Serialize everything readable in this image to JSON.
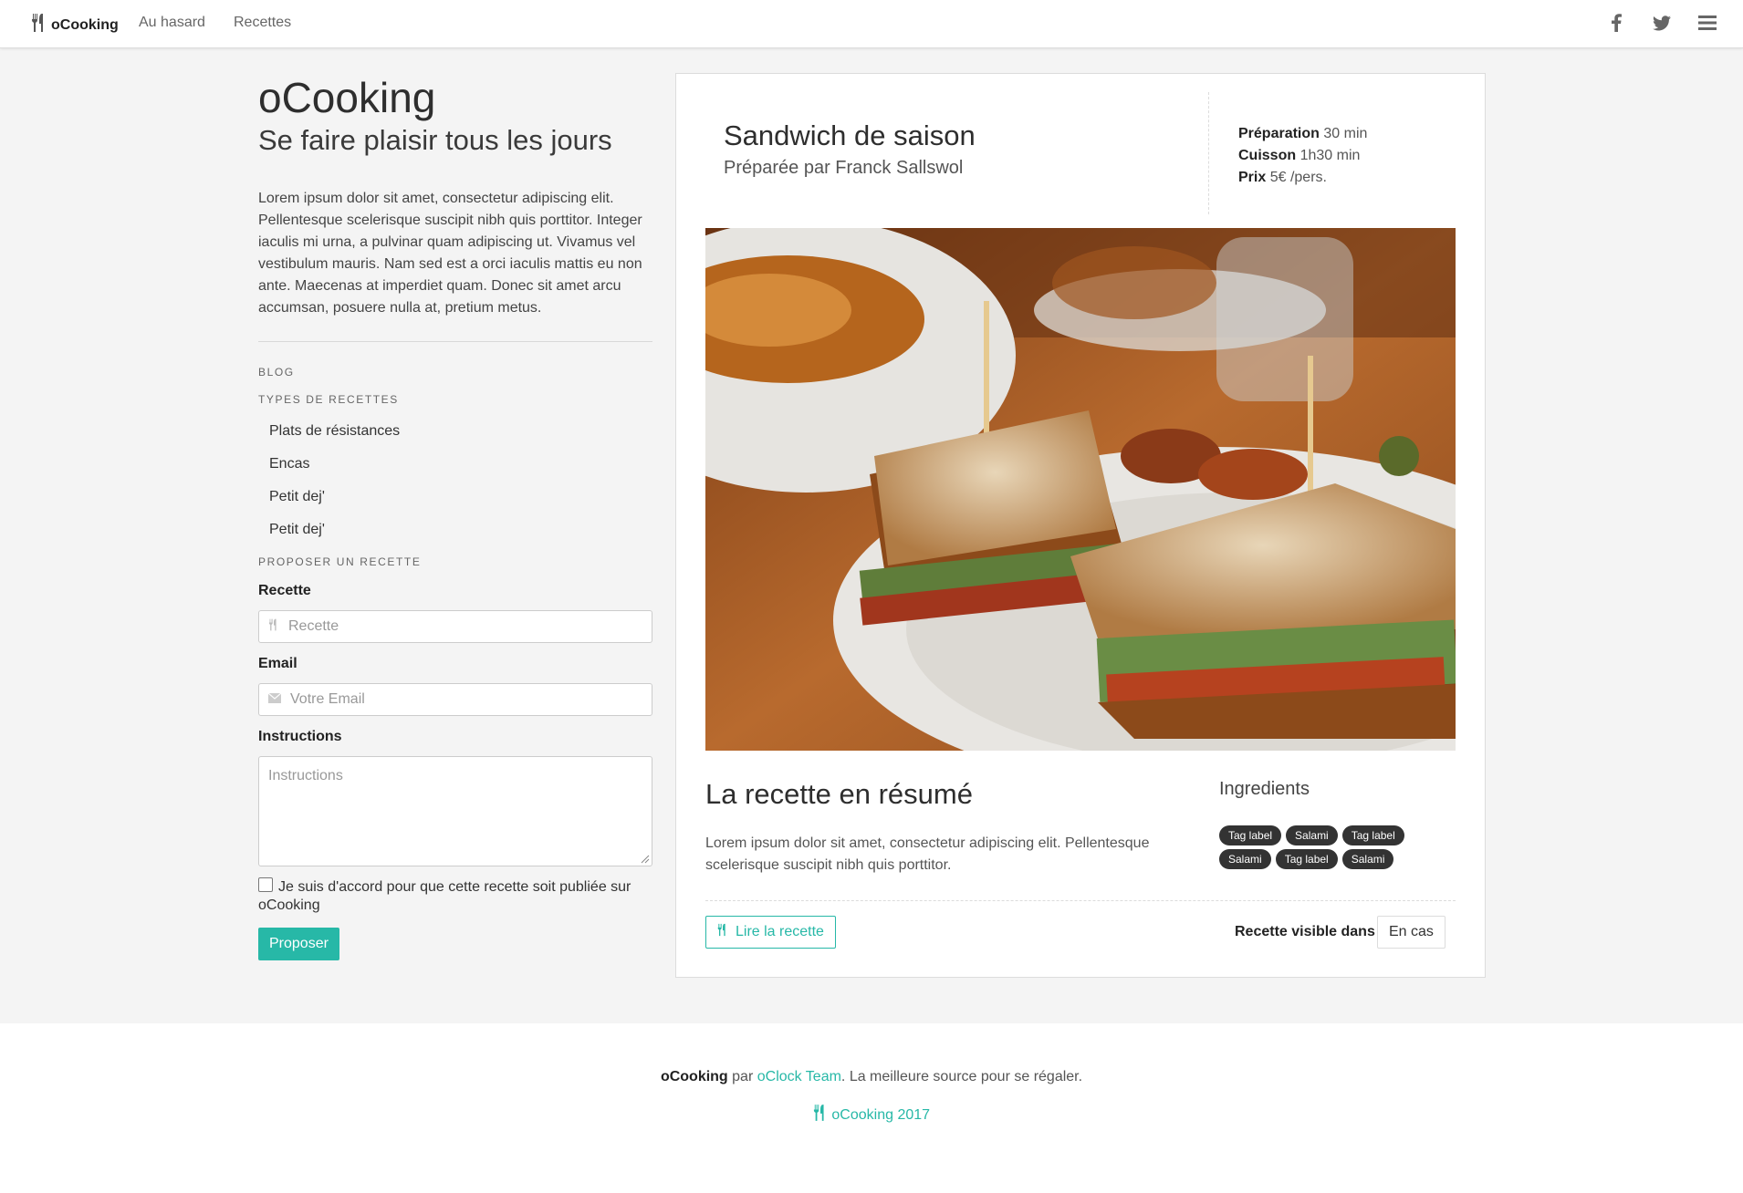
{
  "nav": {
    "brand": "oCooking",
    "links": [
      "Au hasard",
      "Recettes"
    ],
    "icons": [
      "facebook-icon",
      "twitter-icon",
      "menu-icon"
    ]
  },
  "sidebar": {
    "title": "oCooking",
    "tagline": "Se faire plaisir tous les jours",
    "intro": "Lorem ipsum dolor sit amet, consectetur adipiscing elit. Pellentesque scelerisque suscipit nibh quis porttitor. Integer iaculis mi urna, a pulvinar quam adipiscing ut. Vivamus vel vestibulum mauris. Nam sed est a orci iaculis mattis eu non ante. Maecenas at imperdiet quam. Donec sit amet arcu accumsan, posuere nulla at, pretium metus.",
    "blog_heading": "BLOG",
    "types_heading": "TYPES DE RECETTES",
    "types": [
      "Plats de résistances",
      "Encas",
      "Petit dej'",
      "Petit dej'"
    ],
    "propose_heading": "PROPOSER UN RECETTE",
    "form": {
      "recipe_label": "Recette",
      "recipe_placeholder": "Recette",
      "email_label": "Email",
      "email_placeholder": "Votre Email",
      "instructions_label": "Instructions",
      "instructions_placeholder": "Instructions",
      "checkbox_text": "Je suis d'accord pour que cette recette soit publiée sur oCooking",
      "submit": "Proposer"
    }
  },
  "card": {
    "title": "Sandwich de saison",
    "author": "Préparée par Franck Sallswol",
    "meta": [
      {
        "label": "Préparation",
        "value": "30 min"
      },
      {
        "label": "Cuisson",
        "value": "1h30 min"
      },
      {
        "label": "Prix",
        "value": "5€ /pers."
      }
    ],
    "summary_title": "La recette en résumé",
    "summary_text": "Lorem ipsum dolor sit amet, consectetur adipiscing elit. Pellentesque scelerisque suscipit nibh quis porttitor.",
    "ingredients_title": "Ingredients",
    "tags": [
      "Tag label",
      "Salami",
      "Tag label",
      "Salami",
      "Tag label",
      "Salami"
    ],
    "read_button": "Lire la recette",
    "visible_label": "Recette visible dans",
    "visible_value": "En cas"
  },
  "footer": {
    "brand": "oCooking",
    "par": "par",
    "team": "oClock Team",
    "slogan": ". La meilleure source pour se régaler.",
    "copyright": "oCooking 2017"
  },
  "colors": {
    "accent": "#27b8a7",
    "tag_bg": "#333333",
    "page_bg": "#f4f4f4"
  }
}
